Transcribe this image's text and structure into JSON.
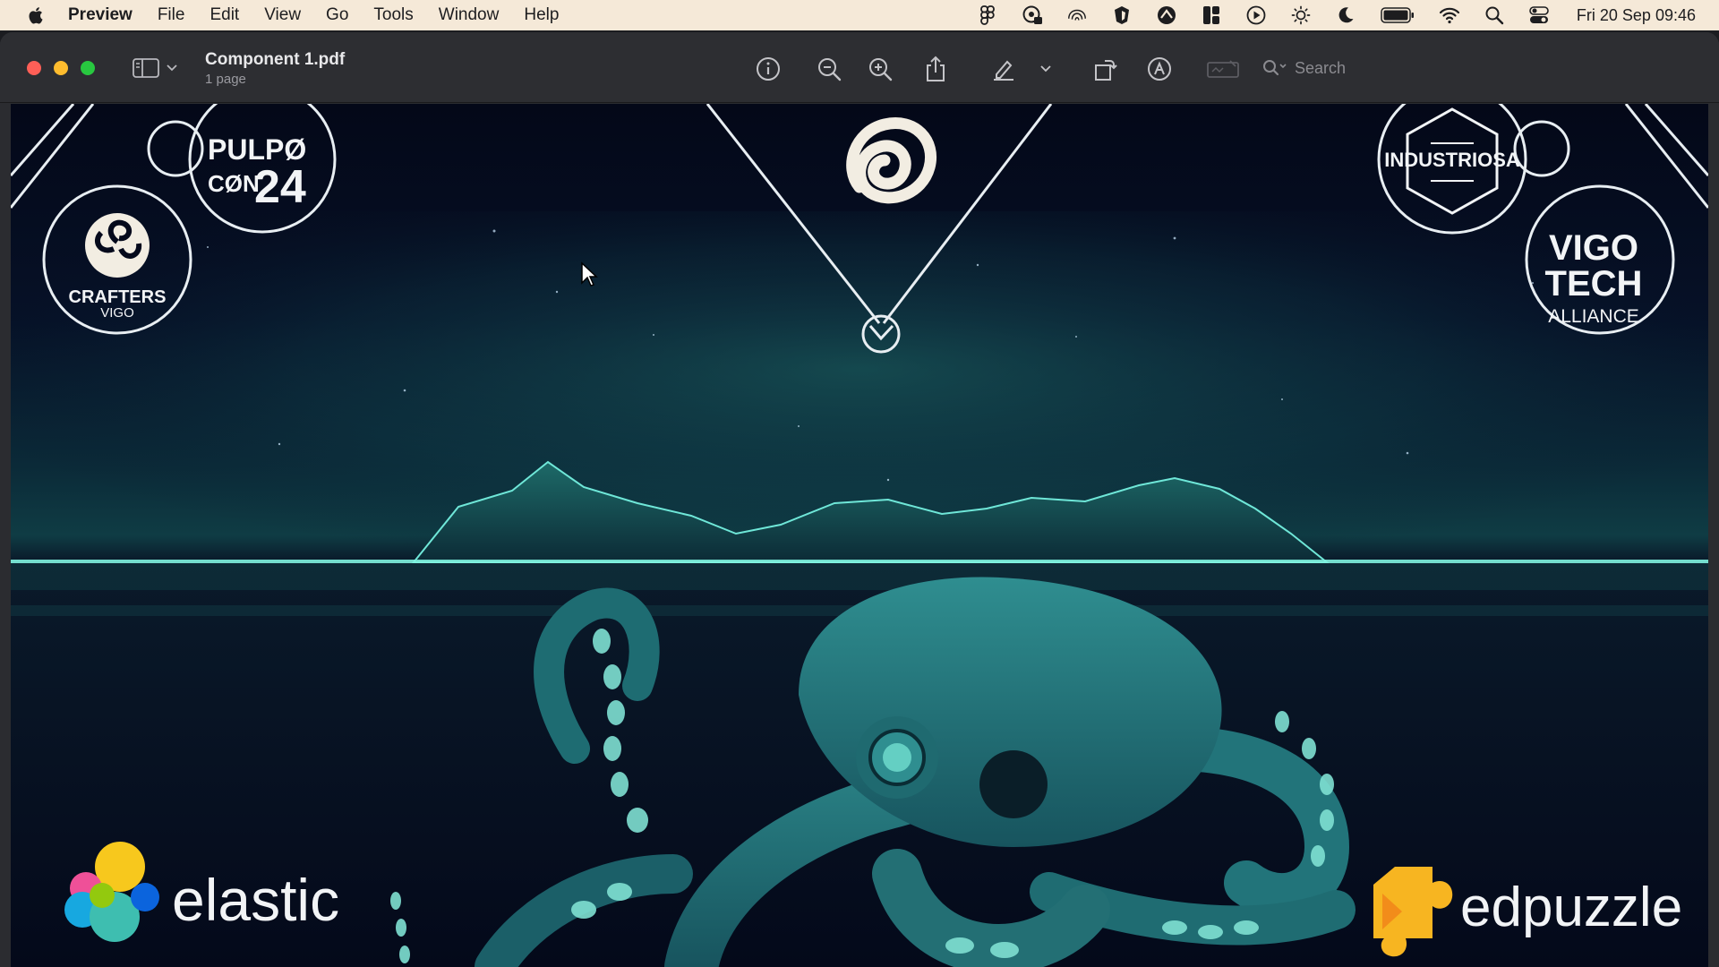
{
  "menubar": {
    "app": "Preview",
    "items": [
      "File",
      "Edit",
      "View",
      "Go",
      "Tools",
      "Window",
      "Help"
    ],
    "clock": "Fri 20 Sep  09:46"
  },
  "window": {
    "title": "Component 1.pdf",
    "subtitle": "1 page",
    "search_placeholder": "Search"
  },
  "poster": {
    "pulpo_line1": "PULPØ",
    "pulpo_line2": "CØN",
    "pulpo_year": "24",
    "crafters": "CRAFTERS",
    "crafters_city": "VIGO",
    "industriosa": "INDUSTRIOSA",
    "vigo_tech_1": "VIGO",
    "vigo_tech_2": "TECH",
    "vigo_tech_3": "ALLIANCE",
    "elastic": "elastic",
    "edpuzzle": "edpuzzle"
  },
  "colors": {
    "menubar_bg": "#f5e9d8",
    "window_bg": "#2d2e32",
    "poster_sky": "#050a1c",
    "poster_teal": "#2f8e90",
    "horizon_glow": "#7ff3e0"
  }
}
